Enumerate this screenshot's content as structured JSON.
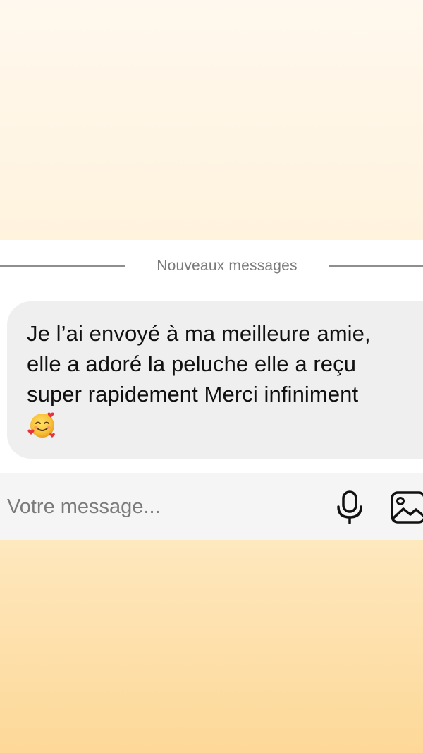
{
  "chat": {
    "divider_label": "Nouveaux messages",
    "message": {
      "text": "Je l’ai envoyé à ma meilleure amie,\nelle a adoré la peluche elle a reçu\nsuper rapidement Merci infiniment",
      "emoji": "smiling-face-with-hearts"
    }
  },
  "composer": {
    "placeholder": "Votre message...",
    "icons": [
      "microphone-icon",
      "gallery-icon"
    ]
  },
  "colors": {
    "bubble": "#efefef",
    "background_top": "#fff8ee",
    "background_bottom": "#fdd898"
  }
}
